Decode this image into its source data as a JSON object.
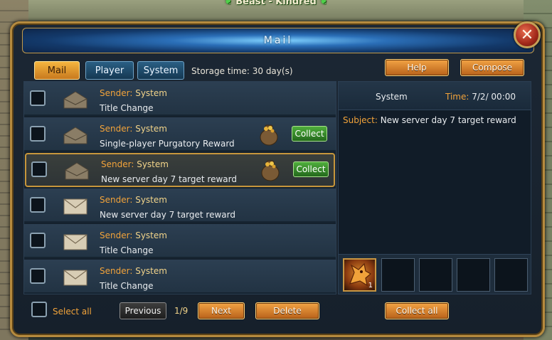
{
  "banner": {
    "title": "Beast - Kindred"
  },
  "window": {
    "title": "Mail"
  },
  "tabs": [
    {
      "label": "Mail",
      "active": true
    },
    {
      "label": "Player",
      "active": false
    },
    {
      "label": "System",
      "active": false
    }
  ],
  "storage_text": "Storage time: 30 day(s)",
  "toolbar": {
    "help_label": "Help",
    "compose_label": "Compose"
  },
  "mails": [
    {
      "sender_label": "Sender:",
      "sender": "System",
      "subject": "Title Change",
      "read": true,
      "has_attachment": false
    },
    {
      "sender_label": "Sender:",
      "sender": "System",
      "subject": "Single-player Purgatory Reward",
      "read": true,
      "has_attachment": true,
      "collect_label": "Collect"
    },
    {
      "sender_label": "Sender:",
      "sender": "System",
      "subject": "New server day 7 target reward",
      "read": true,
      "has_attachment": true,
      "collect_label": "Collect",
      "selected": true
    },
    {
      "sender_label": "Sender:",
      "sender": "System",
      "subject": "New server day 7 target reward",
      "read": false,
      "has_attachment": false
    },
    {
      "sender_label": "Sender:",
      "sender": "System",
      "subject": "Title Change",
      "read": false,
      "has_attachment": false
    },
    {
      "sender_label": "Sender:",
      "sender": "System",
      "subject": "Title Change",
      "read": false,
      "has_attachment": false
    }
  ],
  "detail": {
    "sender": "System",
    "time_label": "Time:",
    "time": "7/2/ 00:00",
    "subject_label": "Subject:",
    "subject": "New server day 7 target reward",
    "attachments": [
      {
        "icon": "dragon-mount-icon",
        "count": "1"
      }
    ]
  },
  "footer": {
    "select_all_label": "Select all",
    "previous_label": "Previous",
    "page": "1/9",
    "next_label": "Next",
    "delete_label": "Delete",
    "collect_all_label": "Collect all"
  },
  "colors": {
    "accent_orange": "#f2a33a",
    "gold_border": "#c6963c",
    "collect_green": "#3f9a30"
  }
}
